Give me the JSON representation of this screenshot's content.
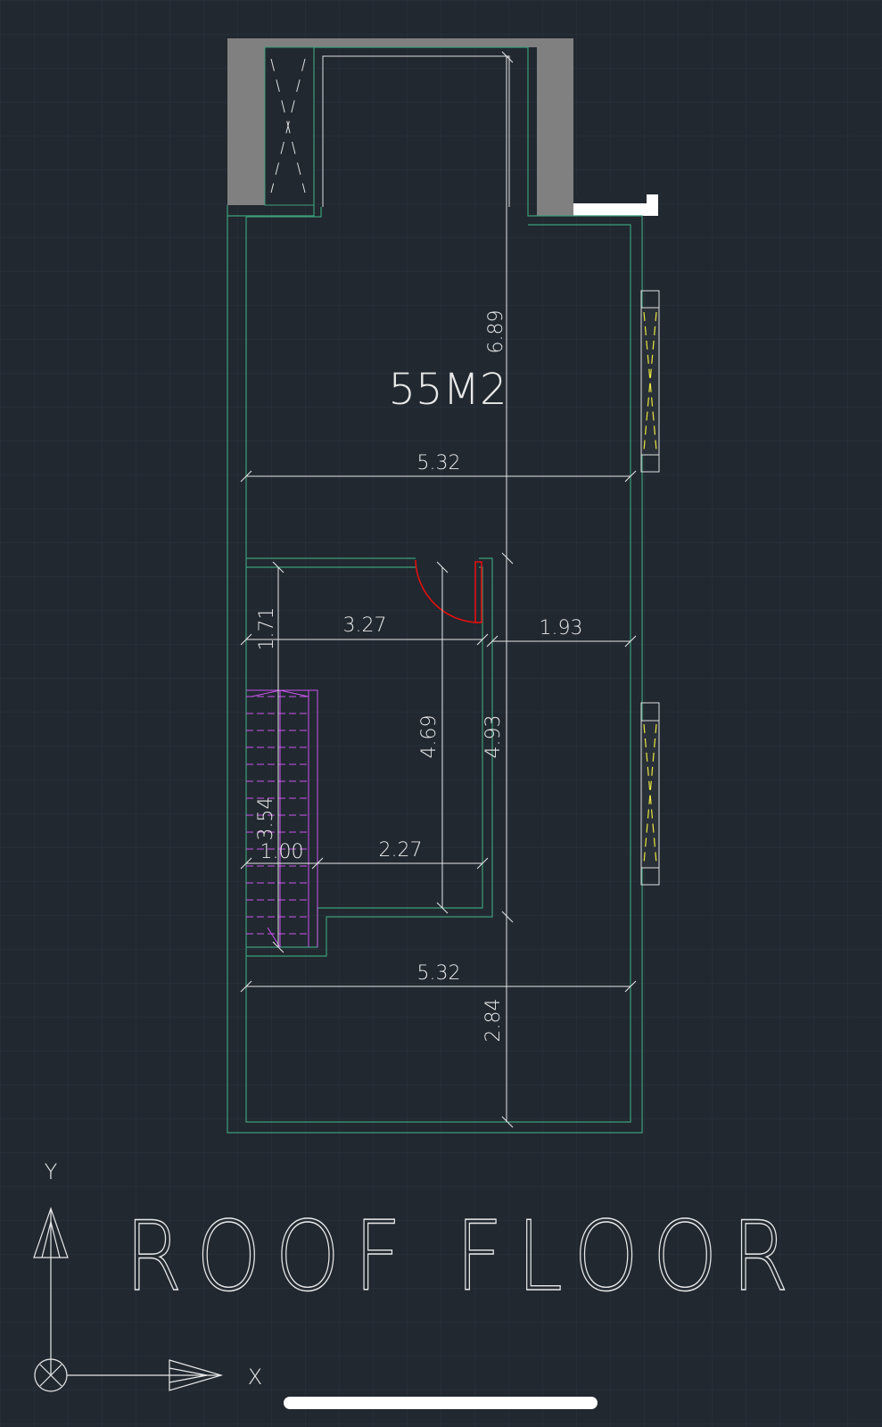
{
  "drawing": {
    "area_label": "55M2",
    "title": "ROOF FLOOR",
    "dimensions": {
      "d_6_89": "6.89",
      "d_5_32_top": "5.32",
      "d_1_71": "1.71",
      "d_3_27": "3.27",
      "d_1_93": "1.93",
      "d_4_69": "4.69",
      "d_4_93": "4.93",
      "d_3_54": "3.54",
      "d_1_00": "1.00",
      "d_2_27": "2.27",
      "d_5_32_bottom": "5.32",
      "d_2_84": "2.84"
    },
    "ucs": {
      "x_label": "X",
      "y_label": "Y"
    }
  },
  "colors": {
    "background": "#212830",
    "grid": "#2c3440",
    "wall": "#808080",
    "outline": "#3d9e7a",
    "dimension": "#e8e8e8",
    "door": "#e01010",
    "stair": "#cc55ee",
    "window_glass": "#e8e840"
  }
}
